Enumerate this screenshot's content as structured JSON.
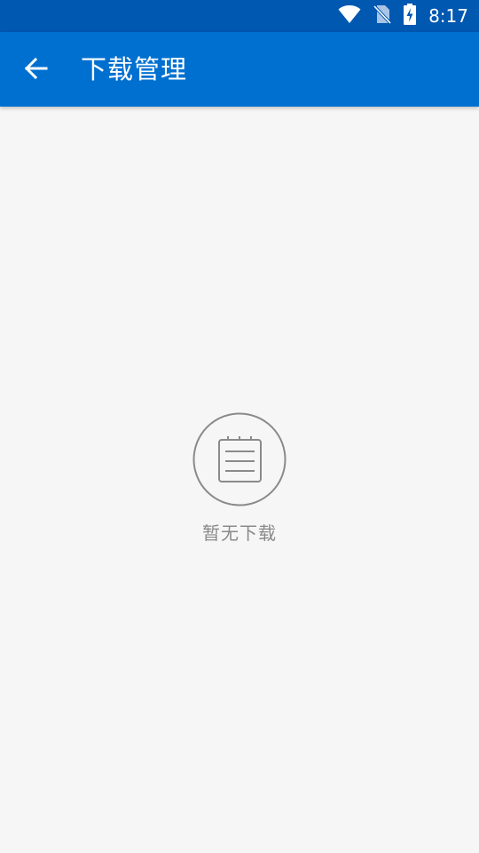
{
  "status_bar": {
    "time": "8:17",
    "icons": [
      "wifi-icon",
      "no-sim-icon",
      "battery-charging-icon"
    ],
    "color": "#0058b0"
  },
  "app_bar": {
    "title": "下载管理",
    "back_icon": "arrow-back-icon",
    "color": "#0070d0"
  },
  "empty_state": {
    "icon": "notepad-icon",
    "message": "暂无下载"
  }
}
